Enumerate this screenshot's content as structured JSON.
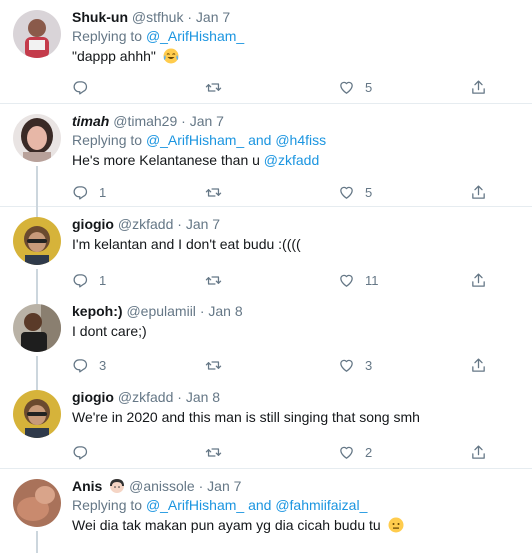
{
  "tweets": [
    {
      "name": "Shuk-un",
      "handle": "@stfhuk",
      "dot": "·",
      "date": "Jan 7",
      "replying_prefix": "Replying to ",
      "replying_to": [
        "@_ArifHisham_"
      ],
      "text": "\"dappp ahhh\"",
      "emoji": "tears-of-joy-emoji",
      "replies": "",
      "retweets": "",
      "likes": "5"
    },
    {
      "name": "timah",
      "handle": "@timah29",
      "dot": "·",
      "date": "Jan 7",
      "replying_prefix": "Replying to ",
      "replying_to": [
        "@_ArifHisham_",
        "@h4fiss"
      ],
      "replying_and": " and ",
      "text": "He's more Kelantanese than u ",
      "text_mention": "@zkfadd",
      "replies": "1",
      "retweets": "",
      "likes": "5"
    },
    {
      "name": "giogio",
      "handle": "@zkfadd",
      "dot": "·",
      "date": "Jan 7",
      "text": "I'm kelantan and I don't eat budu :((((",
      "replies": "1",
      "retweets": "",
      "likes": "11"
    },
    {
      "name": "kepoh:)",
      "handle": "@epulamiil",
      "dot": "·",
      "date": "Jan 8",
      "text": "I dont care;)",
      "replies": "3",
      "retweets": "",
      "likes": "3"
    },
    {
      "name": "giogio",
      "handle": "@zkfadd",
      "dot": "·",
      "date": "Jan 8",
      "text": "We're in 2020 and this man is still singing that song smh",
      "replies": "",
      "retweets": "",
      "likes": "2"
    },
    {
      "name": "Anis",
      "name_emoji": "woman-emoji",
      "handle": "@anissole",
      "dot": "·",
      "date": "Jan 7",
      "replying_prefix": "Replying to ",
      "replying_to": [
        "@_ArifHisham_",
        "@fahmiifaizal_"
      ],
      "replying_and": " and ",
      "text": "Wei dia tak makan pun ayam yg dia cicah budu tu ",
      "emoji": "neutral-face-emoji"
    }
  ],
  "colors": {
    "link": "#1b95e0",
    "secondary": "#657786",
    "divider": "#e6ecf0",
    "thread": "#ccd6dd"
  },
  "icons": [
    "reply-icon",
    "retweet-icon",
    "like-icon",
    "share-icon"
  ]
}
